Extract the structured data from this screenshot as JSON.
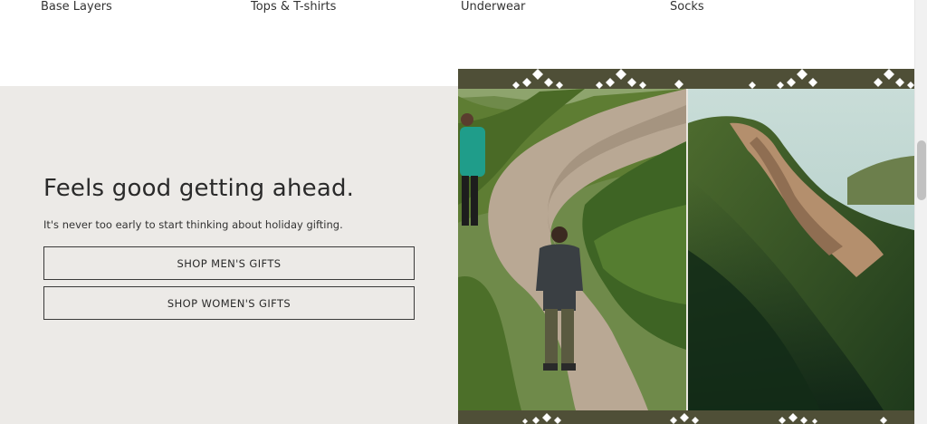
{
  "categories": [
    {
      "label": "Base Layers"
    },
    {
      "label": "Tops & T-shirts"
    },
    {
      "label": "Underwear"
    },
    {
      "label": "Socks"
    }
  ],
  "promo": {
    "headline": "Feels good getting ahead.",
    "subtext": "It's never too early to start thinking about holiday gifting.",
    "buttons": {
      "men": "SHOP MEN'S GIFTS",
      "women": "SHOP WOMEN'S GIFTS"
    }
  },
  "colors": {
    "promo_background": "#eceae7",
    "frame_olive": "#4f4f37"
  },
  "icons": [
    "diamond-pattern-icon"
  ]
}
